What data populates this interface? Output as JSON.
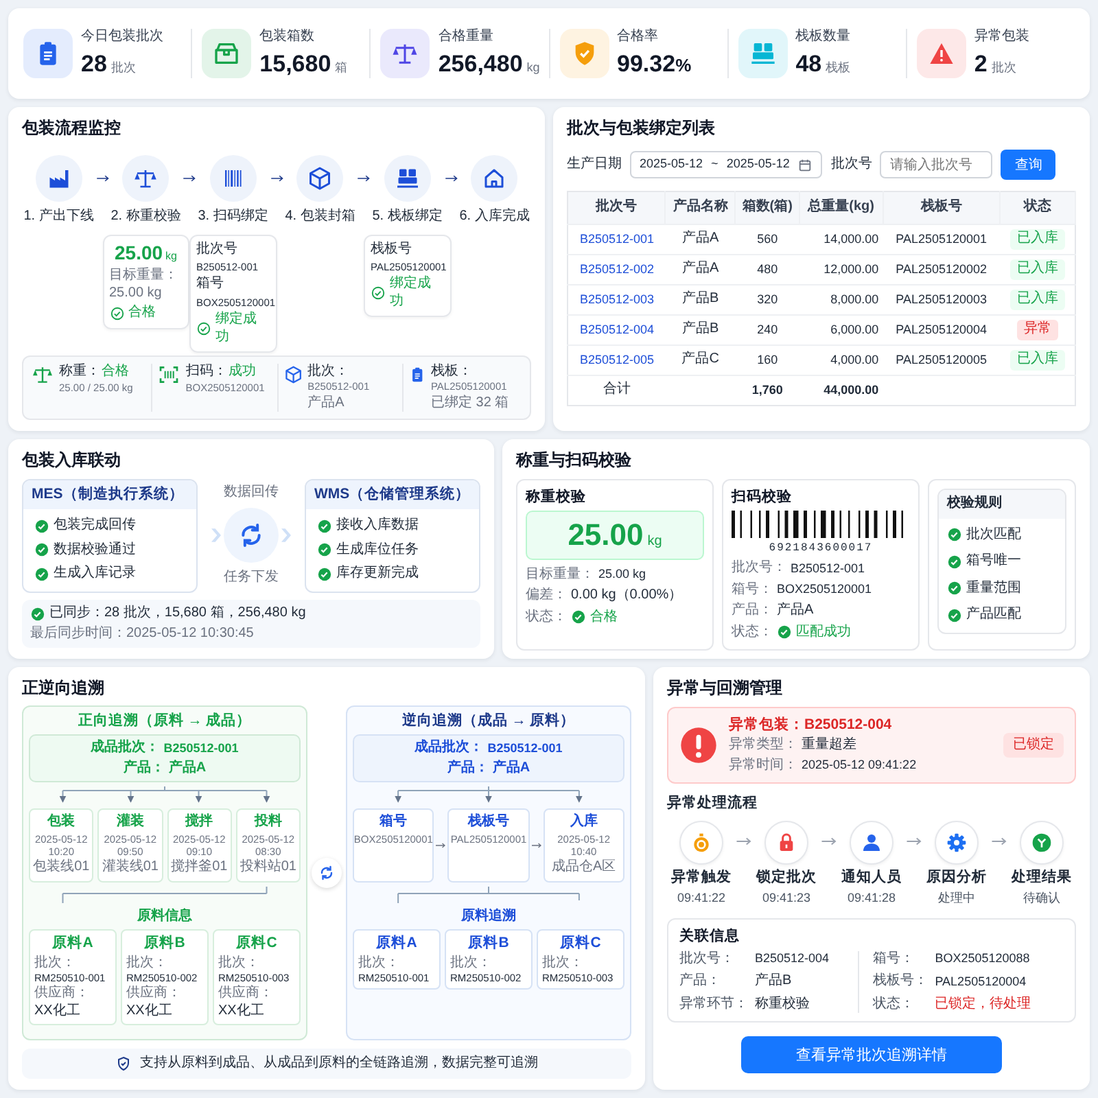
{
  "stats": [
    {
      "label": "今日包装批次",
      "value": "28",
      "unit": "批次",
      "color": "#2563eb"
    },
    {
      "label": "包装箱数",
      "value": "15,680",
      "unit": "箱",
      "color": "#16a34a"
    },
    {
      "label": "合格重量",
      "value": "256,480",
      "unit": "kg",
      "color": "#4f46e5"
    },
    {
      "label": "合格率",
      "value": "99.32",
      "unit": "%",
      "color": "#f59e0b"
    },
    {
      "label": "栈板数量",
      "value": "48",
      "unit": "栈板",
      "color": "#06b6d4"
    },
    {
      "label": "异常包装",
      "value": "2",
      "unit": "批次",
      "color": "#ef4444"
    }
  ],
  "flow": {
    "title": "包装流程监控",
    "steps": [
      {
        "label": "1. 产出下线"
      },
      {
        "label": "2. 称重校验",
        "detail": {
          "kind": "weight",
          "value": "25.00",
          "unit": "kg",
          "note": "目标重量：25.00 kg",
          "status": "合格"
        }
      },
      {
        "label": "3. 扫码绑定",
        "detail": {
          "kind": "fields",
          "fields": [
            {
              "label": "批次号",
              "value": "B250512-001"
            },
            {
              "label": "箱号",
              "value": "BOX2505120001"
            }
          ],
          "status": "绑定成功"
        }
      },
      {
        "label": "4. 包装封箱"
      },
      {
        "label": "5. 栈板绑定",
        "detail": {
          "kind": "fields",
          "fields": [
            {
              "label": "栈板号",
              "value": "PAL2505120001"
            }
          ],
          "status": "绑定成功"
        }
      },
      {
        "label": "6. 入库完成"
      }
    ],
    "summary": [
      {
        "label": "称重：",
        "value": "合格",
        "success": true,
        "sub": "25.00 / 25.00 kg"
      },
      {
        "label": "扫码：",
        "value": "成功",
        "success": true,
        "sub": "BOX2505120001"
      },
      {
        "label": "批次：",
        "value": "B250512-001",
        "success": false,
        "sub": "产品A"
      },
      {
        "label": "栈板：",
        "value": "PAL2505120001",
        "success": false,
        "sub": "已绑定 32 箱"
      }
    ]
  },
  "batches": {
    "title": "批次与包装绑定列表",
    "date": {
      "label": "生产日期",
      "from": "2025-05-12",
      "separator": "~",
      "to": "2025-05-12"
    },
    "batch": {
      "label": "批次号",
      "placeholder": "请输入批次号"
    },
    "button": "查询",
    "columns": [
      "批次号",
      "产品名称",
      "箱数(箱)",
      "总重量(kg)",
      "栈板号",
      "状态"
    ],
    "rows": [
      {
        "batch": "B250512-001",
        "product": "产品A",
        "boxes": "560",
        "weight": "14,000.00",
        "pallet": "PAL2505120001",
        "status": {
          "text": "已入库",
          "kind": "ok"
        }
      },
      {
        "batch": "B250512-002",
        "product": "产品A",
        "boxes": "480",
        "weight": "12,000.00",
        "pallet": "PAL2505120002",
        "status": {
          "text": "已入库",
          "kind": "ok"
        }
      },
      {
        "batch": "B250512-003",
        "product": "产品B",
        "boxes": "320",
        "weight": "8,000.00",
        "pallet": "PAL2505120003",
        "status": {
          "text": "已入库",
          "kind": "ok"
        }
      },
      {
        "batch": "B250512-004",
        "product": "产品B",
        "boxes": "240",
        "weight": "6,000.00",
        "pallet": "PAL2505120004",
        "status": {
          "text": "异常",
          "kind": "error"
        }
      },
      {
        "batch": "B250512-005",
        "product": "产品C",
        "boxes": "160",
        "weight": "4,000.00",
        "pallet": "PAL2505120005",
        "status": {
          "text": "已入库",
          "kind": "ok"
        }
      }
    ],
    "total": {
      "label": "合计",
      "boxes": "1,760",
      "weight": "44,000.00"
    }
  },
  "sync": {
    "title": "包装入库联动",
    "mes": {
      "title": "MES（制造执行系统）",
      "items": [
        "包装完成回传",
        "数据校验通过",
        "生成入库记录"
      ]
    },
    "up_label": "数据回传",
    "down_label": "任务下发",
    "wms": {
      "title": "WMS（仓储管理系统）",
      "items": [
        "接收入库数据",
        "生成库位任务",
        "库存更新完成"
      ]
    },
    "status": "已同步：28 批次，15,680 箱，256,480 kg",
    "last_sync": "最后同步时间：2025-05-12 10:30:45"
  },
  "verify": {
    "title": "称重与扫码校验",
    "weighing": {
      "title": "称重校验",
      "value": "25.00",
      "unit": "kg",
      "rows": [
        {
          "label": "目标重量：",
          "value": "25.00 kg",
          "ok": false
        },
        {
          "label": "偏差：",
          "value": "0.00 kg（0.00%）",
          "ok": false
        },
        {
          "label": "状态：",
          "value": "合格",
          "ok": true
        }
      ]
    },
    "scan": {
      "title": "扫码校验",
      "barcode": "6921843600017",
      "rows": [
        {
          "label": "批次号：",
          "value": "B250512-001",
          "ok": false
        },
        {
          "label": "箱号：",
          "value": "BOX2505120001",
          "ok": false
        },
        {
          "label": "产品：",
          "value": "产品A",
          "ok": false
        },
        {
          "label": "状态：",
          "value": "匹配成功",
          "ok": true
        }
      ]
    },
    "rules": {
      "title": "校验规则",
      "items": [
        "批次匹配",
        "箱号唯一",
        "重量范围",
        "产品匹配"
      ]
    }
  },
  "trace": {
    "title": "正逆向追溯",
    "forward": {
      "title": "正向追溯（原料 → 成品）",
      "header": [
        {
          "label": "成品批次：",
          "value": "B250512-001"
        },
        {
          "label": "产品：",
          "value": "产品A"
        }
      ],
      "stages": [
        {
          "name": "包装",
          "lines": [
            "2025-05-12 10:20",
            "包装线01"
          ]
        },
        {
          "name": "灌装",
          "lines": [
            "2025-05-12 09:50",
            "灌装线01"
          ]
        },
        {
          "name": "搅拌",
          "lines": [
            "2025-05-12 09:10",
            "搅拌釜01"
          ]
        },
        {
          "name": "投料",
          "lines": [
            "2025-05-12 08:30",
            "投料站01"
          ]
        }
      ],
      "materials_label": "原料信息",
      "materials": [
        {
          "name": "原料A",
          "fields": [
            {
              "label": "批次：",
              "value": "RM250510-001"
            },
            {
              "label": "供应商：",
              "value": "XX化工"
            }
          ]
        },
        {
          "name": "原料B",
          "fields": [
            {
              "label": "批次：",
              "value": "RM250510-002"
            },
            {
              "label": "供应商：",
              "value": "XX化工"
            }
          ]
        },
        {
          "name": "原料C",
          "fields": [
            {
              "label": "批次：",
              "value": "RM250510-003"
            },
            {
              "label": "供应商：",
              "value": "XX化工"
            }
          ]
        }
      ]
    },
    "backward": {
      "title": "逆向追溯（成品 → 原料）",
      "header": [
        {
          "label": "成品批次：",
          "value": "B250512-001"
        },
        {
          "label": "产品：",
          "value": "产品A"
        }
      ],
      "stages": [
        {
          "name": "箱号",
          "lines": [
            "BOX2505120001"
          ]
        },
        {
          "name": "栈板号",
          "lines": [
            "PAL2505120001"
          ]
        },
        {
          "name": "入库",
          "lines": [
            "2025-05-12 10:40",
            "成品仓A区"
          ]
        }
      ],
      "materials_label": "原料追溯",
      "materials": [
        {
          "name": "原料A",
          "fields": [
            {
              "label": "批次：",
              "value": "RM250510-001"
            }
          ]
        },
        {
          "name": "原料B",
          "fields": [
            {
              "label": "批次：",
              "value": "RM250510-002"
            }
          ]
        },
        {
          "name": "原料C",
          "fields": [
            {
              "label": "批次：",
              "value": "RM250510-003"
            }
          ]
        }
      ]
    },
    "note": "支持从原料到成品、从成品到原料的全链路追溯，数据完整可追溯"
  },
  "exception": {
    "title": "异常与回溯管理",
    "alert": {
      "title": "异常包装：B250512-004",
      "fields": [
        {
          "label": "异常类型：",
          "value": "重量超差"
        },
        {
          "label": "异常时间：",
          "value": "2025-05-12 09:41:22"
        }
      ],
      "badge": "已锁定"
    },
    "process_title": "异常处理流程",
    "process": [
      {
        "label": "异常触发",
        "time": "09:41:22",
        "color": "#f59e0b"
      },
      {
        "label": "锁定批次",
        "time": "09:41:23",
        "color": "#ef4444"
      },
      {
        "label": "通知人员",
        "time": "09:41:28",
        "color": "#2563eb"
      },
      {
        "label": "原因分析",
        "time": "处理中",
        "color": "#1d6ff2"
      },
      {
        "label": "处理结果",
        "time": "待确认",
        "color": "#16a34a"
      }
    ],
    "info": {
      "title": "关联信息",
      "left": [
        {
          "label": "批次号：",
          "value": "B250512-004",
          "alert": false
        },
        {
          "label": "产品：",
          "value": "产品B",
          "alert": false
        },
        {
          "label": "异常环节：",
          "value": "称重校验",
          "alert": false
        }
      ],
      "right": [
        {
          "label": "箱号：",
          "value": "BOX2505120088",
          "alert": false
        },
        {
          "label": "栈板号：",
          "value": "PAL2505120004",
          "alert": false
        },
        {
          "label": "状态：",
          "value": "已锁定，待处理",
          "alert": true
        }
      ]
    },
    "button": "查看异常批次追溯详情"
  }
}
